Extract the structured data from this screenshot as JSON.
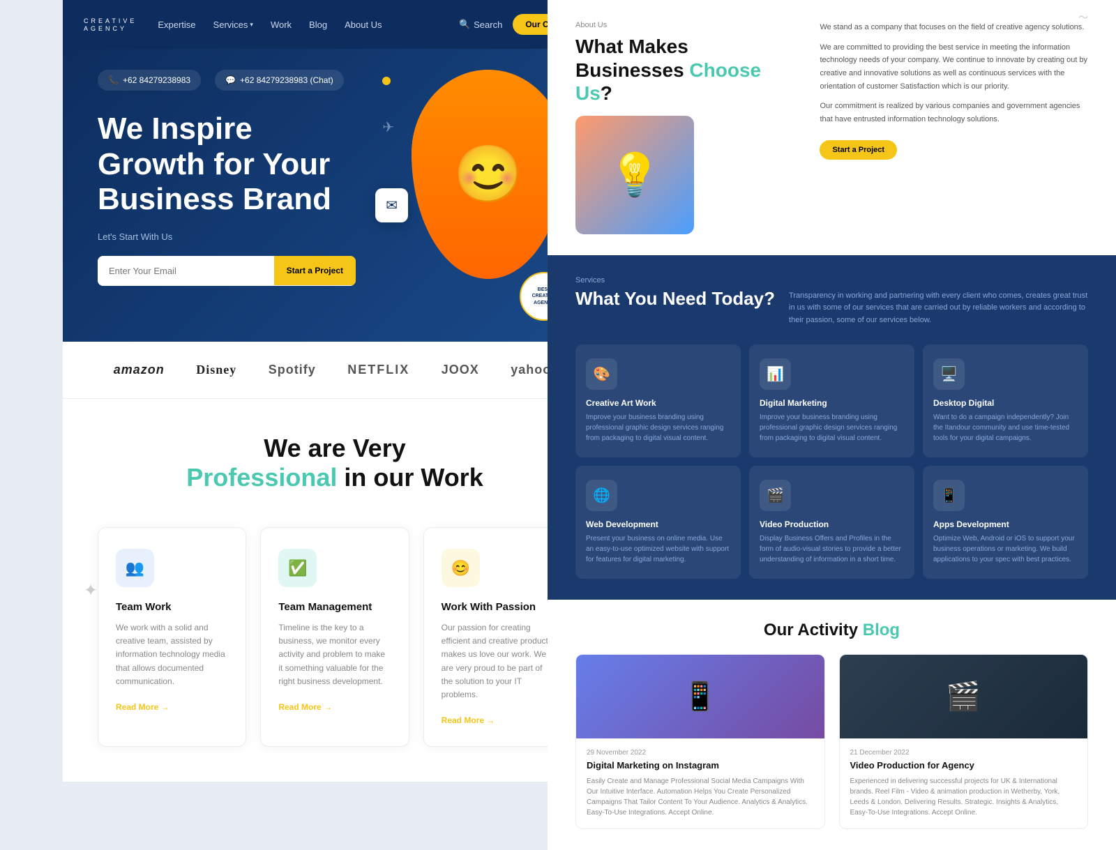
{
  "navbar": {
    "logo_text": "CREATIVE",
    "logo_sub": "AGENCY",
    "links": [
      {
        "label": "Expertise",
        "has_dropdown": false
      },
      {
        "label": "Services",
        "has_dropdown": true
      },
      {
        "label": "Work",
        "has_dropdown": false
      },
      {
        "label": "Blog",
        "has_dropdown": false
      },
      {
        "label": "About Us",
        "has_dropdown": false
      }
    ],
    "search_label": "Search",
    "cta_label": "Our Catalog"
  },
  "hero": {
    "phone1": "+62 84279238983",
    "phone2": "+62 84279238983 (Chat)",
    "title_line1": "We Inspire",
    "title_line2": "Growth for Your",
    "title_line3": "Business Brand",
    "subtitle": "Let's Start With Us",
    "email_placeholder": "Enter Your Email",
    "cta_label": "Start a Project",
    "badge_text": "BEST CREATIVE AGENCY"
  },
  "brands": [
    {
      "name": "amazon",
      "label": "amazon"
    },
    {
      "name": "disney",
      "label": "Disney"
    },
    {
      "name": "spotify",
      "label": "Spotify"
    },
    {
      "name": "netflix",
      "label": "NETFLIX"
    },
    {
      "name": "joox",
      "label": "JOOX"
    },
    {
      "name": "yahoo",
      "label": "yahoo!"
    }
  ],
  "professional": {
    "title_line1": "We are Very",
    "title_highlight": "Professional",
    "title_line2": "in our Work",
    "cards": [
      {
        "icon": "👥",
        "icon_style": "blue",
        "title": "Team Work",
        "text": "We work with a solid and creative team, assisted by information technology media that allows documented communication.",
        "link_label": "Read More →"
      },
      {
        "icon": "✅",
        "icon_style": "teal",
        "title": "Team Management",
        "text": "Timeline is the key to a business, we monitor every activity and problem to make it something valuable for the right business development.",
        "link_label": "Read More →"
      },
      {
        "icon": "😊",
        "icon_style": "yellow",
        "title": "Work With Passion",
        "text": "Our passion for creating efficient and creative products makes us love our work. We are very proud to be part of the solution to your IT problems.",
        "link_label": "Read More →"
      }
    ]
  },
  "about": {
    "section_label": "About Us",
    "title_line1": "What Makes",
    "title_line2": "Businesses",
    "title_highlight": "Choose Us",
    "title_suffix": "?",
    "texts": [
      "We stand as a company that focuses on the field of creative agency solutions.",
      "We are committed to providing the best service in meeting the information technology needs of your company. We continue to innovate by creating out by creative and innovative solutions as well as continuous services with the orientation of customer Satisfaction which is our priority.",
      "Our commitment is realized by various companies and government agencies that have entrusted information technology solutions."
    ],
    "cta_label": "Start a Project",
    "image_emoji": "💡"
  },
  "services": {
    "section_label": "Services",
    "title": "What You Need Today?",
    "description": "Transparency in working and partnering with every client who comes, creates great trust in us with some of our services that are carried out by reliable workers and according to their passion, some of our services below.",
    "cards": [
      {
        "icon": "🎨",
        "title": "Creative Art Work",
        "text": "Improve your business branding using professional graphic design services ranging from packaging to digital visual content."
      },
      {
        "icon": "📊",
        "title": "Digital Marketing",
        "text": "Improve your business branding using professional graphic design services ranging from packaging to digital visual content."
      },
      {
        "icon": "🖥️",
        "title": "Desktop Digital",
        "text": "Want to do a campaign independently? Join the Itandour community and use time-tested tools for your digital campaigns."
      },
      {
        "icon": "🌐",
        "title": "Web Development",
        "text": "Present your business on online media. Use an easy-to-use optimized website with support for features for digital marketing."
      },
      {
        "icon": "🎬",
        "title": "Video Production",
        "text": "Display Business Offers and Profiles in the form of audio-visual stories to provide a better understanding of information in a short time."
      },
      {
        "icon": "📱",
        "title": "Apps Development",
        "text": "Optimize Web, Android or iOS to support your business operations or marketing. We build applications to your spec with best practices."
      }
    ]
  },
  "blog": {
    "title_line1": "Our Activity",
    "title_highlight": "Blog",
    "posts": [
      {
        "date": "29 November 2022",
        "title": "Digital Marketing on Instagram",
        "text": "Easily Create and Manage Professional Social Media Campaigns With Our Intuitive Interface. Automation Helps You Create Personalized Campaigns That Tailor Content To Your Audience. Analytics & Analytics. Easy-To-Use Integrations. Accept Online.",
        "image_emoji": "📱",
        "image_style": "purple"
      },
      {
        "date": "21 December 2022",
        "title": "Video Production for Agency",
        "text": "Experienced in delivering successful projects for UK & International brands. Reel Film - Video & animation production in Wetherby, York, Leeds & London. Delivering Results. Strategic. Insights & Analytics, Easy-To-Use Integrations. Accept Online.",
        "image_emoji": "🎬",
        "image_style": "dark"
      }
    ]
  }
}
